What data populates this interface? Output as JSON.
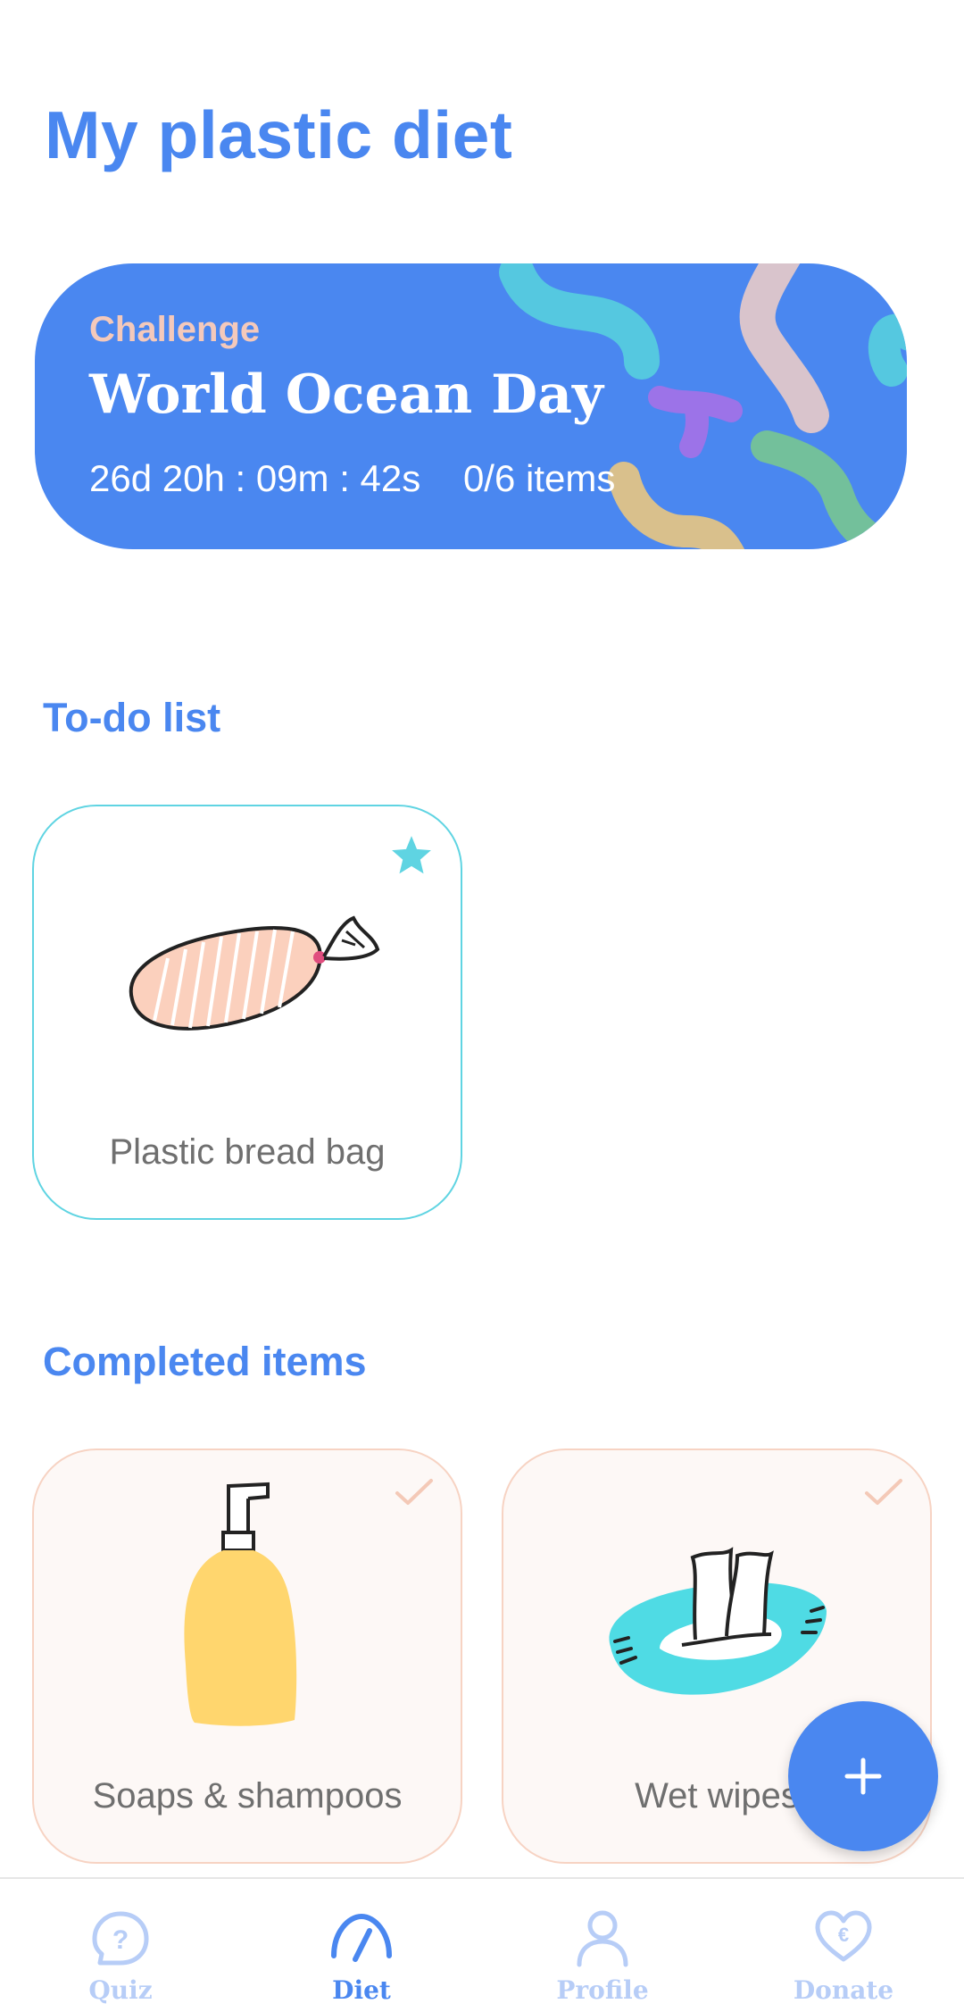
{
  "page": {
    "title": "My plastic diet"
  },
  "challenge": {
    "label": "Challenge",
    "title": "World Ocean Day",
    "countdown": "26d 20h : 09m : 42s",
    "progress": "0/6 items"
  },
  "todo": {
    "title": "To-do list",
    "items": [
      {
        "label": "Plastic bread bag",
        "icon": "bread-bag-icon",
        "starred": true
      }
    ]
  },
  "completed": {
    "title": "Completed items",
    "items": [
      {
        "label": "Soaps & shampoos",
        "icon": "soap-bottle-icon",
        "checked": true
      },
      {
        "label": "Wet wipes",
        "icon": "wet-wipes-icon",
        "checked": true
      }
    ]
  },
  "fab": {
    "icon": "plus-icon"
  },
  "nav": {
    "items": [
      {
        "label": "Quiz",
        "icon": "quiz-icon",
        "active": false
      },
      {
        "label": "Diet",
        "icon": "gauge-icon",
        "active": true
      },
      {
        "label": "Profile",
        "icon": "profile-icon",
        "active": false
      },
      {
        "label": "Donate",
        "icon": "heart-euro-icon",
        "active": false
      }
    ]
  },
  "colors": {
    "brand": "#4a87f0",
    "todo_border": "#5fd4e2",
    "done_border": "#f7d3c3",
    "nav_inactive": "#b7cdf7"
  }
}
